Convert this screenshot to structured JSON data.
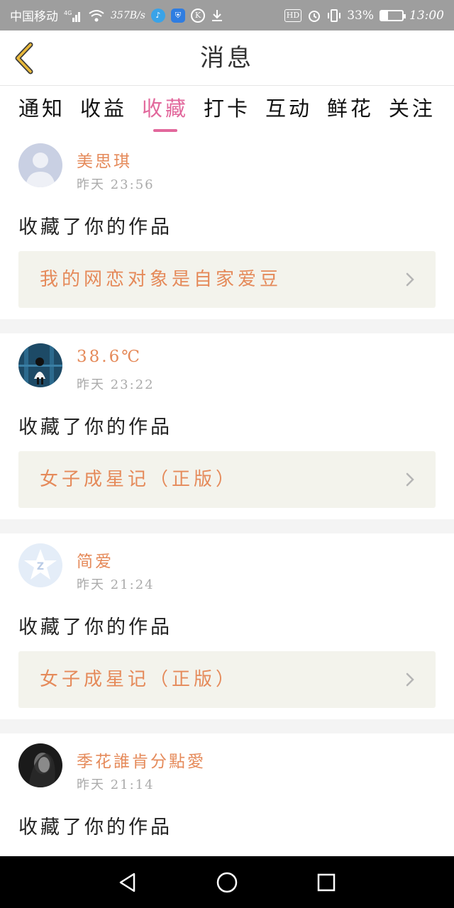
{
  "status_bar": {
    "carrier": "中国移动",
    "network": "4G",
    "speed": "357B/s",
    "battery": "33%",
    "battery_level": 0.33,
    "time": "13:00",
    "hd_label": "HD"
  },
  "header": {
    "title": "消息"
  },
  "tabs": [
    {
      "label": "通知",
      "active": false
    },
    {
      "label": "收益",
      "active": false
    },
    {
      "label": "收藏",
      "active": true
    },
    {
      "label": "打卡",
      "active": false
    },
    {
      "label": "互动",
      "active": false
    },
    {
      "label": "鲜花",
      "active": false
    },
    {
      "label": "关注",
      "active": false
    }
  ],
  "messages": [
    {
      "username": "美思琪",
      "time": "昨天  23:56",
      "action": "收藏了你的作品",
      "work": "我的网恋对象是自家爱豆",
      "avatar": "default-person"
    },
    {
      "username": "38.6℃",
      "time": "昨天  23:22",
      "action": "收藏了你的作品",
      "work": "女子成星记（正版）",
      "avatar": "photo-girl"
    },
    {
      "username": "简爱",
      "time": "昨天  21:24",
      "action": "收藏了你的作品",
      "work": "女子成星记（正版）",
      "avatar": "qq-default"
    },
    {
      "username": "季花誰肯分點愛",
      "time": "昨天  21:14",
      "action": "收藏了你的作品",
      "work": "",
      "avatar": "photo-dark"
    }
  ],
  "colors": {
    "accent": "#e2689c",
    "name": "#e58a5a",
    "back": "#e8b83a",
    "card_bg": "#f3f3ec"
  },
  "icons": [
    "back-icon",
    "chevron-right-icon",
    "back-nav-icon",
    "home-nav-icon",
    "recents-nav-icon"
  ]
}
